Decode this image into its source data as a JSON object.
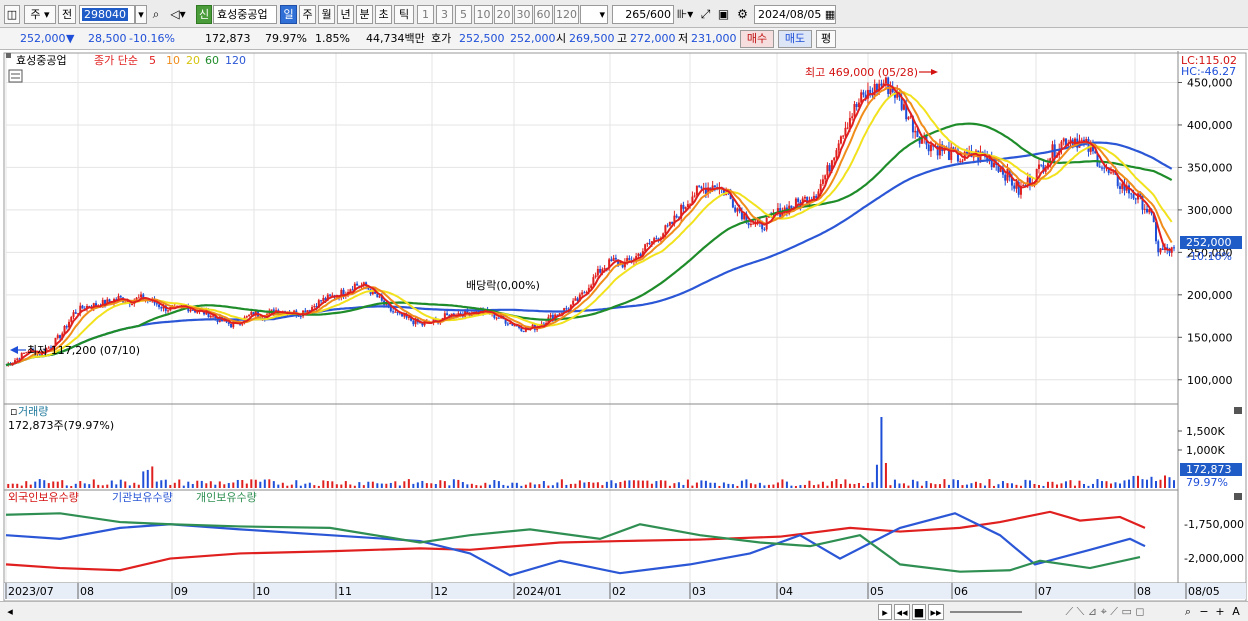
{
  "toolbar": {
    "market": "주",
    "period_mode": "전",
    "stock_code": "298040",
    "credit_badge": "신",
    "stock_name": "효성중공업",
    "period_tabs": [
      "일",
      "주",
      "월",
      "년",
      "분",
      "초",
      "틱"
    ],
    "selected_period": "일",
    "minute_presets": [
      "1",
      "3",
      "5",
      "10",
      "20",
      "30",
      "60",
      "120"
    ],
    "candle_count": "265",
    "candle_total": "/600",
    "date": "2024/08/05"
  },
  "quote": {
    "price": "252,000",
    "change": "28,500",
    "change_pct": "-10.16%",
    "volume": "172,873",
    "volume_ratio": "79.97%",
    "turnover": "1.85%",
    "amount": "44,734백만",
    "ask_label": "호가",
    "ask": "252,500",
    "bid": "252,000",
    "open_label": "시",
    "open": "269,500",
    "high_label": "고",
    "high": "272,000",
    "low_label": "저",
    "low": "231,000",
    "buy_label": "매수",
    "sell_label": "매도",
    "eval_label": "평"
  },
  "chart_data": [
    {
      "type": "candlestick",
      "title": "효성중공업",
      "indicator_legend": {
        "label": "종가 단순",
        "periods": [
          "5",
          "10",
          "20",
          "60",
          "120"
        ]
      },
      "ma_colors": {
        "5": "#e01f1f",
        "10": "#f08c1a",
        "20": "#f2e21e",
        "60": "#1f8c2a",
        "120": "#2b57d6"
      },
      "up_color": "#e01f1f",
      "down_color": "#1f4fd8",
      "y_ticks": [
        "100,000",
        "150,000",
        "200,000",
        "250,000",
        "300,000",
        "350,000",
        "400,000",
        "450,000"
      ],
      "ylim": [
        75000,
        480000
      ],
      "current_price_label": "252,000",
      "current_change_label": "-10.16%",
      "lc_label": "LC:115.02",
      "hc_label": "HC:-46.27",
      "high_annotation": "최고 469,000 (05/28)",
      "low_annotation": "최저 117,200 (07/10)",
      "dividend_annotation": "배당락(0,00%)",
      "close_path": [
        [
          0,
          117200
        ],
        [
          5,
          125000
        ],
        [
          10,
          135000
        ],
        [
          15,
          131000
        ],
        [
          20,
          140000
        ],
        [
          25,
          155000
        ],
        [
          30,
          178000
        ],
        [
          35,
          186000
        ],
        [
          40,
          188000
        ],
        [
          45,
          191000
        ],
        [
          50,
          196000
        ],
        [
          55,
          193000
        ],
        [
          60,
          196000
        ],
        [
          65,
          192000
        ],
        [
          70,
          185000
        ],
        [
          75,
          182000
        ],
        [
          80,
          186000
        ],
        [
          85,
          181000
        ],
        [
          90,
          178000
        ],
        [
          95,
          170000
        ],
        [
          100,
          165000
        ],
        [
          105,
          170000
        ],
        [
          110,
          178000
        ],
        [
          115,
          176000
        ],
        [
          120,
          182000
        ],
        [
          125,
          180000
        ],
        [
          130,
          178000
        ],
        [
          135,
          184000
        ],
        [
          140,
          193000
        ],
        [
          145,
          198000
        ],
        [
          150,
          203000
        ],
        [
          155,
          212000
        ],
        [
          160,
          210000
        ],
        [
          165,
          197000
        ],
        [
          170,
          183000
        ],
        [
          175,
          175000
        ],
        [
          180,
          170000
        ],
        [
          185,
          165000
        ],
        [
          190,
          168000
        ],
        [
          195,
          174000
        ],
        [
          200,
          178000
        ],
        [
          205,
          179000
        ],
        [
          210,
          181000
        ],
        [
          215,
          178000
        ],
        [
          220,
          172000
        ],
        [
          225,
          166000
        ],
        [
          230,
          160000
        ],
        [
          235,
          162000
        ],
        [
          240,
          170000
        ],
        [
          245,
          178000
        ],
        [
          250,
          185000
        ],
        [
          255,
          196000
        ],
        [
          260,
          215000
        ],
        [
          265,
          232000
        ],
        [
          270,
          240000
        ],
        [
          275,
          236000
        ],
        [
          280,
          245000
        ],
        [
          285,
          258000
        ],
        [
          290,
          270000
        ],
        [
          295,
          280000
        ],
        [
          300,
          300000
        ],
        [
          305,
          318000
        ],
        [
          310,
          325000
        ],
        [
          315,
          330000
        ],
        [
          320,
          320000
        ],
        [
          325,
          302000
        ],
        [
          330,
          288000
        ],
        [
          335,
          280000
        ],
        [
          340,
          290000
        ],
        [
          345,
          300000
        ],
        [
          350,
          305000
        ],
        [
          355,
          312000
        ],
        [
          360,
          321000
        ],
        [
          365,
          345000
        ],
        [
          370,
          385000
        ],
        [
          375,
          410000
        ],
        [
          380,
          430000
        ],
        [
          385,
          440000
        ],
        [
          390,
          450000
        ],
        [
          395,
          438000
        ],
        [
          400,
          415000
        ],
        [
          405,
          390000
        ],
        [
          410,
          378000
        ],
        [
          415,
          372000
        ],
        [
          420,
          365000
        ],
        [
          425,
          360000
        ],
        [
          430,
          365000
        ],
        [
          435,
          362000
        ],
        [
          440,
          355000
        ],
        [
          445,
          340000
        ],
        [
          450,
          322000
        ],
        [
          455,
          335000
        ],
        [
          460,
          350000
        ],
        [
          465,
          368000
        ],
        [
          470,
          382000
        ],
        [
          475,
          384000
        ],
        [
          480,
          375000
        ],
        [
          485,
          360000
        ],
        [
          490,
          342000
        ],
        [
          495,
          330000
        ],
        [
          500,
          320000
        ],
        [
          505,
          308000
        ],
        [
          508,
          296000
        ],
        [
          510,
          282000
        ],
        [
          512,
          252000
        ]
      ],
      "volume_panel": {
        "title": "거래량",
        "current": "172,873주(79.97%)",
        "y_ticks": [
          "1,000K",
          "1,500K"
        ],
        "current_label": "172,873",
        "current_pct": "79.97%"
      },
      "holdings_panel": {
        "series": [
          {
            "name": "외국인보유수량",
            "color": "#e01f1f"
          },
          {
            "name": "기관보유수량",
            "color": "#2b57d6"
          },
          {
            "name": "개인보유수량",
            "color": "#2f8f52"
          }
        ],
        "y_ticks": [
          "-1,750,000",
          "-2,000,000"
        ]
      },
      "x_ticks": [
        "2023/07",
        "08",
        "09",
        "10",
        "11",
        "12",
        "2024/01",
        "02",
        "03",
        "04",
        "05",
        "06",
        "07",
        "08",
        "08/05"
      ]
    }
  ],
  "statusbar": {
    "nav_buttons": [
      "▸",
      "◂◂",
      "■",
      "▸▸"
    ],
    "zoom_buttons": [
      "−",
      "+",
      "A"
    ]
  }
}
